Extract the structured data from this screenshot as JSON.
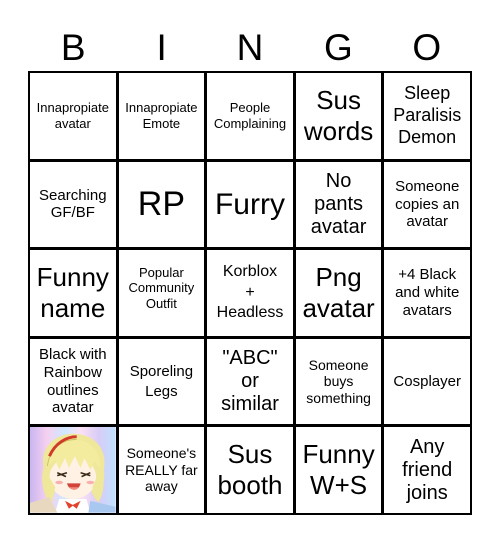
{
  "header": {
    "letters": [
      "B",
      "I",
      "N",
      "G",
      "O"
    ]
  },
  "board": {
    "rows": [
      [
        "Innapropiate avatar",
        "Innapropiate Emote",
        "People Complaining",
        "Sus words",
        "Sleep Paralisis Demon"
      ],
      [
        "Searching GF/BF",
        "RP",
        "Furry",
        "No pants avatar",
        "Someone copies an avatar"
      ],
      [
        "Funny name",
        "Popular Community Outfit",
        "Korblox + Headless",
        "Png avatar",
        "+4 Black and white avatars"
      ],
      [
        "Black with Rainbow outlines avatar",
        "Sporeling Legs",
        "\"ABC\" or similar",
        "Someone buys something",
        "Cosplayer"
      ],
      [
        "",
        "Someone's REALLY far away",
        "Sus booth",
        "Funny W+S",
        "Any friend joins"
      ]
    ],
    "free_space": {
      "position": "row 5, column 1",
      "content": "anime-character-image"
    }
  },
  "colors": {
    "grid_line": "#000000",
    "cell_background": "#ffffff",
    "text": "#000000"
  }
}
